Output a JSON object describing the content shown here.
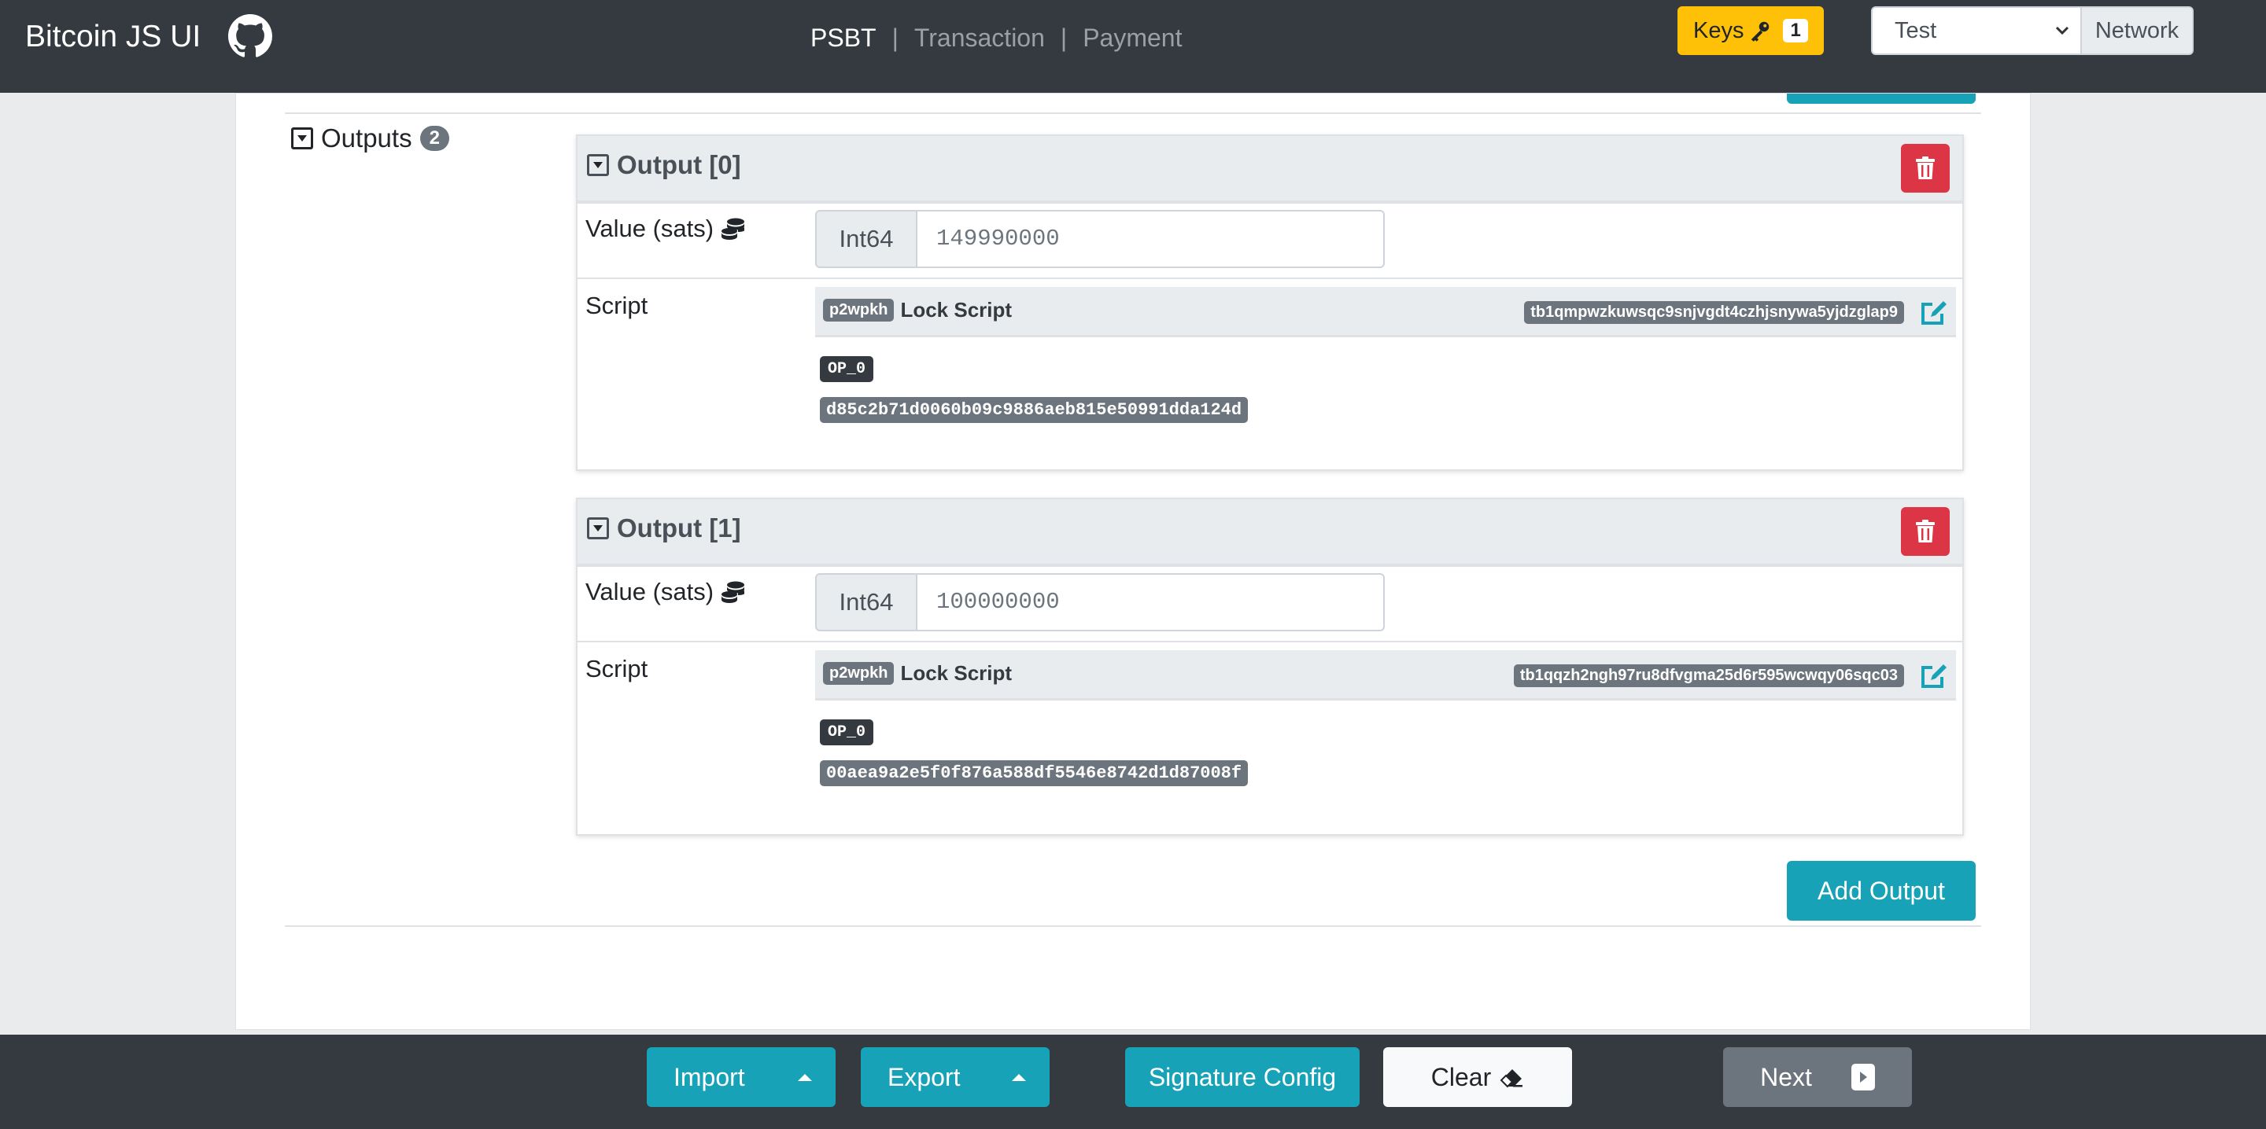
{
  "app": {
    "title": "Bitcoin JS UI"
  },
  "nav": {
    "items": [
      {
        "label": "PSBT",
        "active": true
      },
      {
        "label": "Transaction",
        "active": false
      },
      {
        "label": "Payment",
        "active": false
      }
    ],
    "separator": "|"
  },
  "header": {
    "keys_label": "Keys",
    "keys_count": "1",
    "network_value": "Test",
    "network_label": "Network"
  },
  "outputs": {
    "label": "Outputs",
    "count": "2",
    "items": [
      {
        "title": "Output [0]",
        "value_label": "Value (sats)",
        "value_type": "Int64",
        "value": "149990000",
        "script_label": "Script",
        "script_type": "p2wpkh",
        "lock_script_label": "Lock Script",
        "address": "tb1qmpwzkuwsqc9snjvgdt4czhjsnywa5yjdzglap9",
        "opcode": "OP_0",
        "hex": "d85c2b71d0060b09c9886aeb815e50991dda124d"
      },
      {
        "title": "Output [1]",
        "value_label": "Value (sats)",
        "value_type": "Int64",
        "value": "100000000",
        "script_label": "Script",
        "script_type": "p2wpkh",
        "lock_script_label": "Lock Script",
        "address": "tb1qqzh2ngh97ru8dfvgma25d6r595wcwqy06sqc03",
        "opcode": "OP_0",
        "hex": "00aea9a2e5f0f876a588df5546e8742d1d87008f"
      }
    ],
    "add_button": "Add Output"
  },
  "footer": {
    "import": "Import",
    "export": "Export",
    "signature_config": "Signature Config",
    "clear": "Clear",
    "next": "Next"
  },
  "colors": {
    "navbar": "#343a40",
    "accent": "#17a2b8",
    "warning": "#ffc107",
    "danger": "#dc3545",
    "secondary": "#6c757d"
  },
  "icons": [
    "github-icon",
    "key-icon",
    "chevron-down-icon",
    "coins-icon",
    "trash-icon",
    "edit-icon",
    "caret-down-square-icon",
    "caret-up-icon",
    "eraser-icon",
    "next-icon"
  ]
}
